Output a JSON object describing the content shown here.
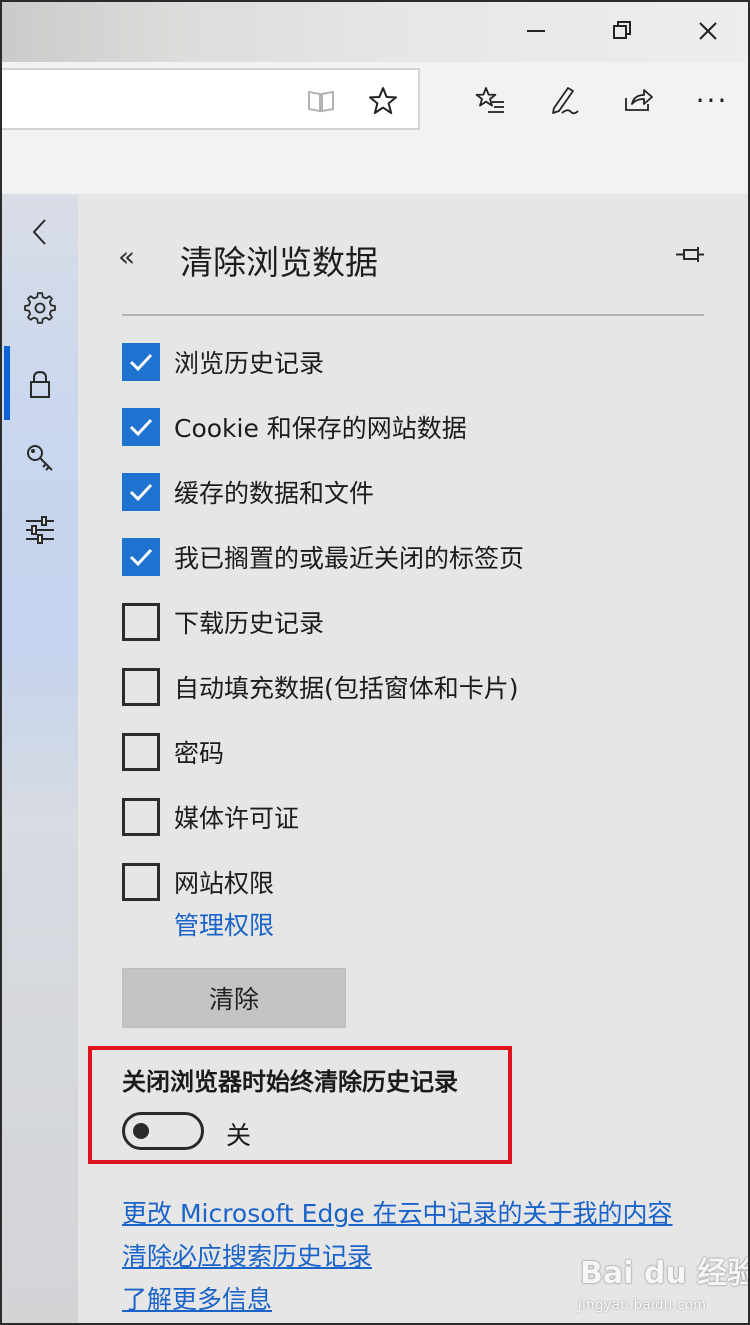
{
  "icons": {
    "minimize": "minimize-icon",
    "restore": "restore-icon",
    "close": "close-icon",
    "reading_view": "reading-view-icon",
    "favorite": "star-icon",
    "favorites_hub": "favorites-list-icon",
    "web_note": "pen-icon",
    "share": "share-icon",
    "more": "more-icon",
    "nav_back": "chevron-left-icon",
    "nav_general": "gear-icon",
    "nav_privacy": "lock-icon",
    "nav_passwords": "key-icon",
    "nav_advanced": "sliders-icon",
    "panel_back": "double-chevron-left-icon",
    "pin": "pin-icon"
  },
  "colors": {
    "accent": "#1e73d0",
    "link": "#1a63c9",
    "highlight_box": "#e0141e",
    "active_nav": "#0a64d8"
  },
  "toolbar": {
    "more_label": "···"
  },
  "panel": {
    "back_label": "«",
    "title": "清除浏览数据",
    "options": [
      {
        "label": "浏览历史记录",
        "checked": true
      },
      {
        "label": "Cookie 和保存的网站数据",
        "checked": true
      },
      {
        "label": "缓存的数据和文件",
        "checked": true
      },
      {
        "label": "我已搁置的或最近关闭的标签页",
        "checked": true
      },
      {
        "label": "下载历史记录",
        "checked": false
      },
      {
        "label": "自动填充数据(包括窗体和卡片)",
        "checked": false
      },
      {
        "label": "密码",
        "checked": false
      },
      {
        "label": "媒体许可证",
        "checked": false
      },
      {
        "label": "网站权限",
        "checked": false
      }
    ],
    "manage_link": "管理权限",
    "clear_button": "清除",
    "always_clear": {
      "title": "关闭浏览器时始终清除历史记录",
      "state": "关",
      "on": false
    },
    "links": [
      "更改 Microsoft Edge 在云中记录的关于我的内容",
      "清除必应搜索历史记录",
      "了解更多信息"
    ]
  },
  "watermark": {
    "main": "Bai du 经验",
    "sub": "jingyan.baidu.com"
  }
}
